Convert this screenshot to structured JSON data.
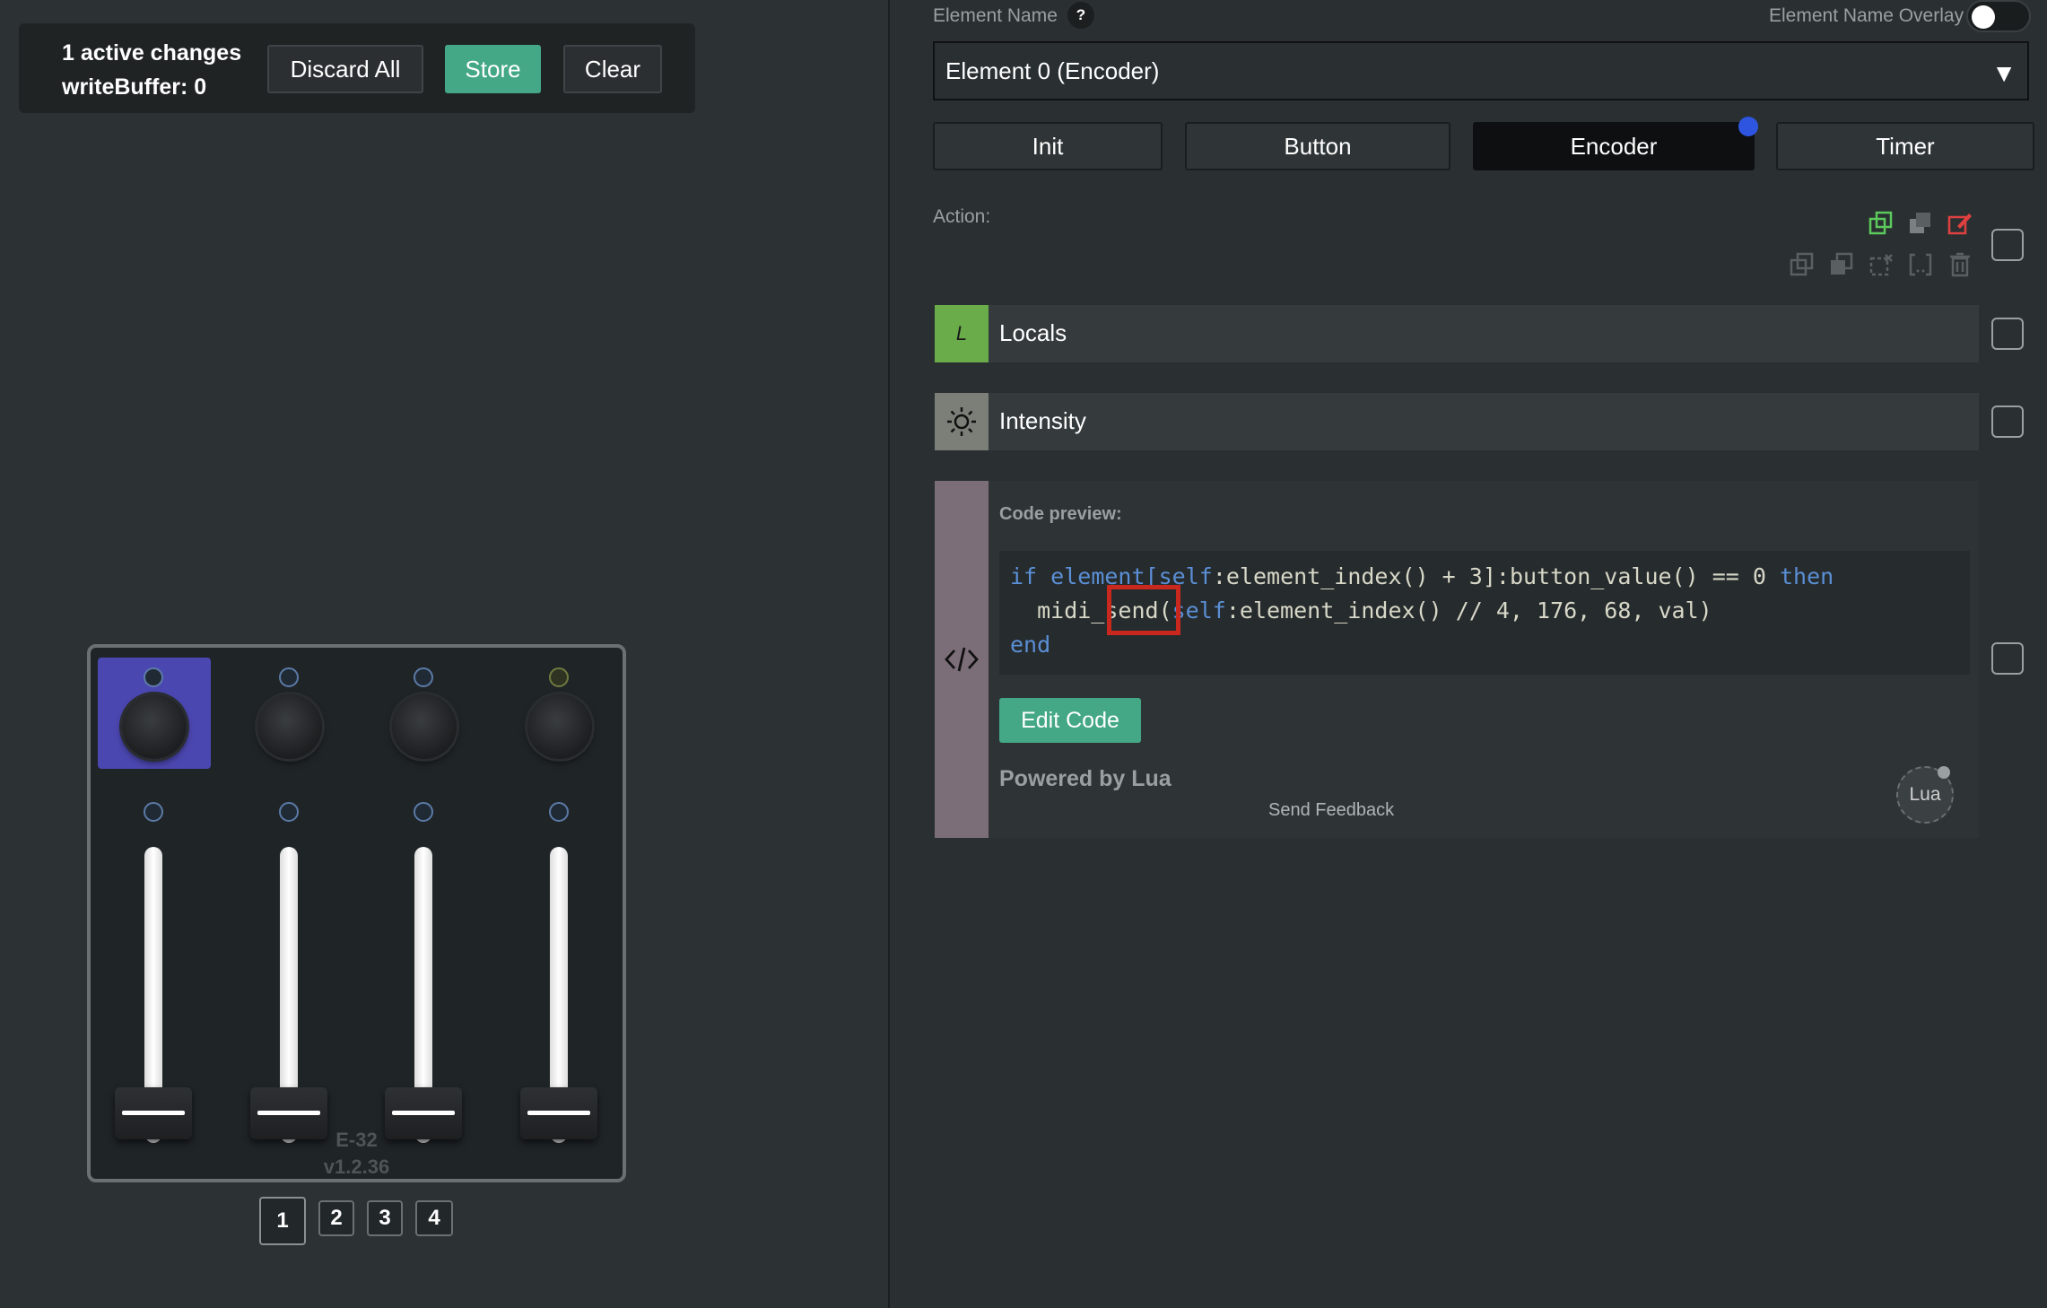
{
  "changes": {
    "active_text": "1 active changes",
    "write_buffer": "writeBuffer: 0",
    "discard_label": "Discard All",
    "store_label": "Store",
    "clear_label": "Clear"
  },
  "device": {
    "name": "E-32",
    "version": "v1.2.36",
    "pages": [
      "1",
      "2",
      "3",
      "4"
    ],
    "active_page": "1"
  },
  "config": {
    "element_name_label": "Element Name",
    "help_text": "?",
    "overlay_label": "Element Name Overlay",
    "overlay_enabled": false,
    "selected_element": "Element 0 (Encoder)",
    "dropdown_arrow": "▼",
    "events": [
      "Init",
      "Button",
      "Encoder",
      "Timer"
    ],
    "active_event": "Encoder",
    "action_label": "Action:",
    "blocks": {
      "locals": {
        "icon_text": "L",
        "title": "Locals"
      },
      "intensity": {
        "title": "Intensity"
      }
    },
    "code": {
      "preview_label": "Code preview:",
      "line1_kw1": "if",
      "line1_a": "element[",
      "line1_kw2": "self",
      "line1_b": ":element_index() + 3]:button_value() == 0 ",
      "line1_kw3": "then",
      "line2_a": "  midi_send(",
      "line2_kw": "self",
      "line2_b": ":element_index() // 4, 176, 68, val)",
      "line3_kw": "end",
      "edit_label": "Edit Code",
      "powered_by": "Powered by Lua",
      "feedback": "Send Feedback",
      "lua_logo": "Lua"
    }
  },
  "colors": {
    "accent_green": "#44a886",
    "selected_knob": "#4b47b0",
    "active_dot": "#2d55e0",
    "highlight_red": "#c8281e"
  }
}
